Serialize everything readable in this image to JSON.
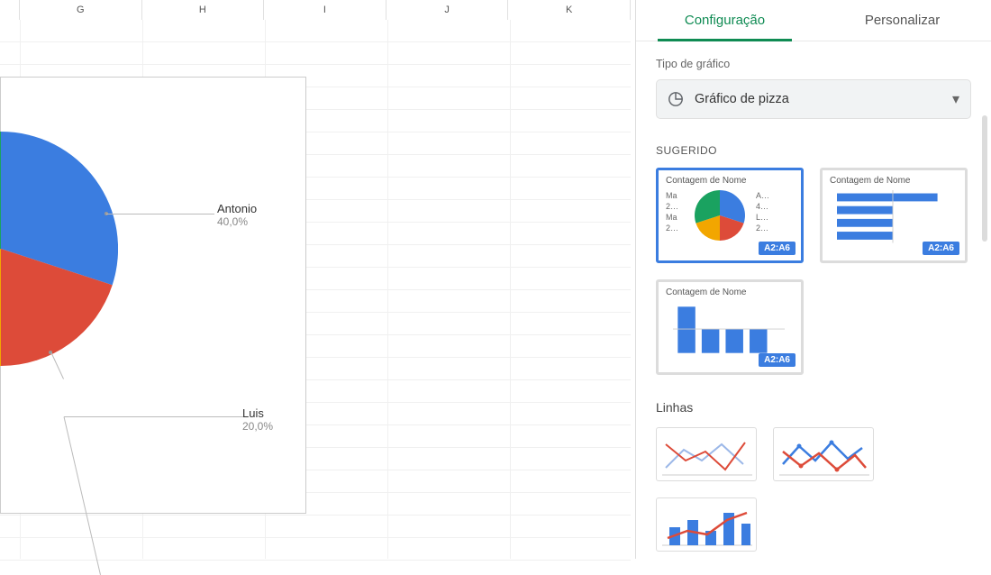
{
  "columns": [
    "",
    "G",
    "H",
    "I",
    "J",
    "K"
  ],
  "panel": {
    "tab_setup": "Configuração",
    "tab_customize": "Personalizar",
    "field_chart_type": "Tipo de gráfico",
    "dropdown_value": "Gráfico de pizza",
    "section_suggested": "SUGERIDO",
    "section_lines": "Linhas",
    "thumb_title": "Contagem de Nome",
    "range_tag": "A2:A6",
    "mini_labels_left": [
      "Ma",
      "2…",
      "Ma",
      "2…"
    ],
    "mini_labels_right": [
      "A…",
      "4…",
      "L…",
      "2…"
    ]
  },
  "chart_data": {
    "type": "pie",
    "title": "",
    "values": [
      {
        "name": "Antonio",
        "pct": 40.0,
        "color": "#3b7de0"
      },
      {
        "name": "Luis",
        "pct": 20.0,
        "color": "#dd4b39"
      }
    ],
    "hidden_slices_pct": 40.0
  }
}
